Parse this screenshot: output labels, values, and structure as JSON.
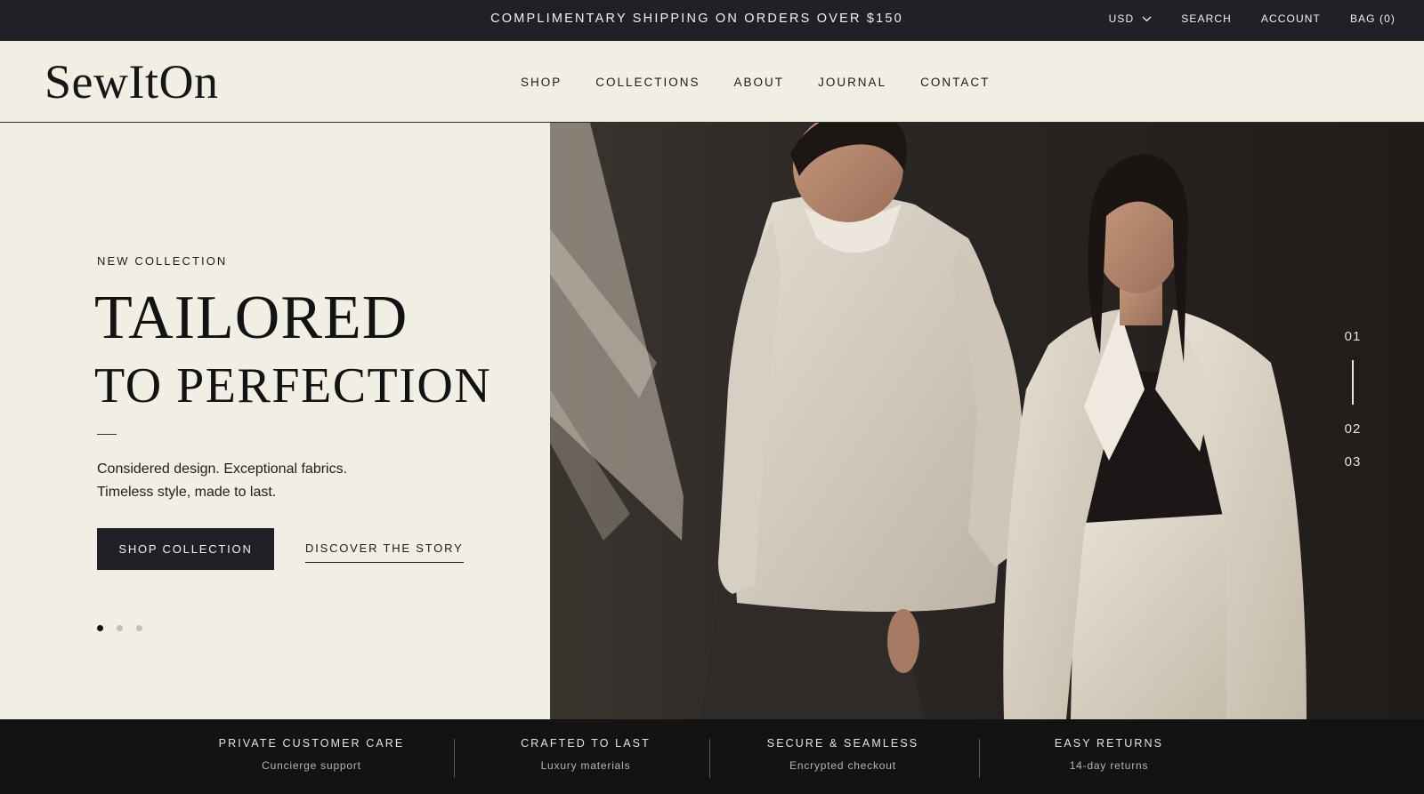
{
  "announcement": {
    "text": "COMPLIMENTARY SHIPPING ON ORDERS OVER $150"
  },
  "utility_nav": {
    "currency": "USD",
    "search": "SEARCH",
    "account": "ACCOUNT",
    "bag": "BAG (0)"
  },
  "header": {
    "logo": "SewItOn",
    "nav": [
      "SHOP",
      "COLLECTIONS",
      "ABOUT",
      "JOURNAL",
      "CONTACT"
    ]
  },
  "hero": {
    "eyebrow": "NEW COLLECTION",
    "headline_line1": "TAILORED",
    "headline_line2": "TO PERFECTION",
    "subtext_line1": "Considered design. Exceptional fabrics.",
    "subtext_line2": "Timeless style, made to last.",
    "primary_cta": "SHOP COLLECTION",
    "secondary_cta": "DISCOVER THE STORY",
    "carousel_dots": 3,
    "active_dot": 1,
    "slide_numbers": [
      "01",
      "02",
      "03"
    ],
    "active_slide": "01"
  },
  "features": [
    {
      "title": "PRIVATE CUSTOMER CARE",
      "subtitle": "Cuncierge support"
    },
    {
      "title": "CRAFTED TO LAST",
      "subtitle": "Luxury materials"
    },
    {
      "title": "SECURE & SEAMLESS",
      "subtitle": "Encrypted checkout"
    },
    {
      "title": "EASY RETURNS",
      "subtitle": "14-day returns"
    }
  ],
  "colors": {
    "cream": "#f1eee3",
    "charcoal": "#222026",
    "footer_black": "#131313",
    "text_dark": "#1c1b1d"
  }
}
